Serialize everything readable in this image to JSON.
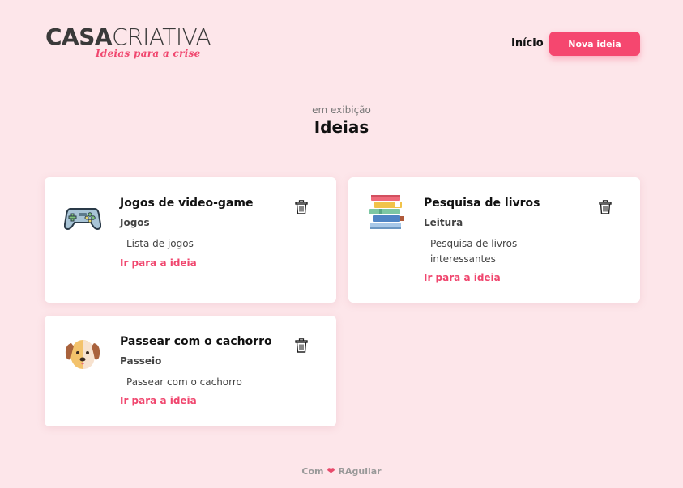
{
  "brand": {
    "name_part1": "CASA",
    "name_part2": "CRIATIVA",
    "tagline": "Ideias para a crise"
  },
  "nav": {
    "home_label": "Início",
    "new_idea_label": "Nova ideia"
  },
  "section": {
    "subtitle": "em exibição",
    "title": "Ideias"
  },
  "ideas": [
    {
      "title": "Jogos de video-game",
      "category": "Jogos",
      "description": "Lista de jogos",
      "link_label": "Ir para a ideia",
      "icon": "gamepad-icon"
    },
    {
      "title": "Pesquisa de livros",
      "category": "Leitura",
      "description": "Pesquisa de livros interessantes",
      "link_label": "Ir para a ideia",
      "icon": "books-icon"
    },
    {
      "title": "Passear com o cachorro",
      "category": "Passeio",
      "description": "Passear com o cachorro",
      "link_label": "Ir para a ideia",
      "icon": "dog-icon"
    }
  ],
  "footer": {
    "prefix": "Com",
    "author": "RAguilar"
  },
  "colors": {
    "background": "#fde6ea",
    "accent": "#f5476f",
    "card": "#ffffff"
  }
}
